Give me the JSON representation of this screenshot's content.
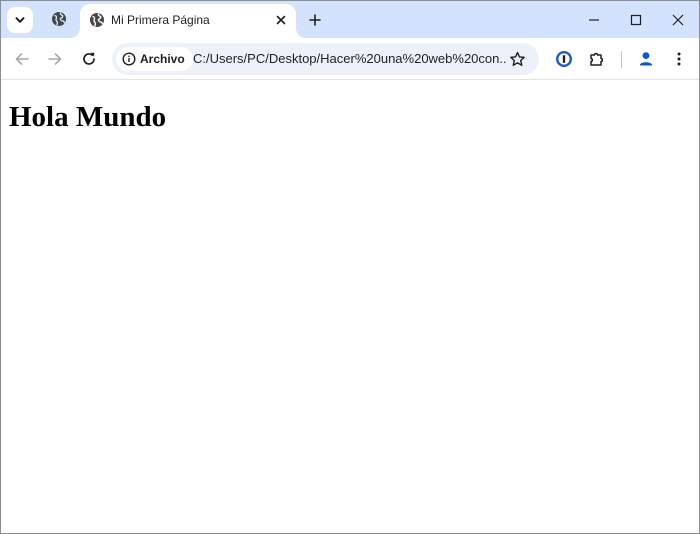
{
  "tab": {
    "title": "Mi Primera Página"
  },
  "omnibox": {
    "security_chip": "Archivo",
    "url": "C:/Users/PC/Desktop/Hacer%20una%20web%20con..."
  },
  "page": {
    "heading": "Hola Mundo"
  },
  "colors": {
    "tabstrip_bg": "#d3e3fd",
    "omnibox_bg": "#edf2fa",
    "profile_icon": "#0b57d0",
    "icon": "#474747"
  }
}
